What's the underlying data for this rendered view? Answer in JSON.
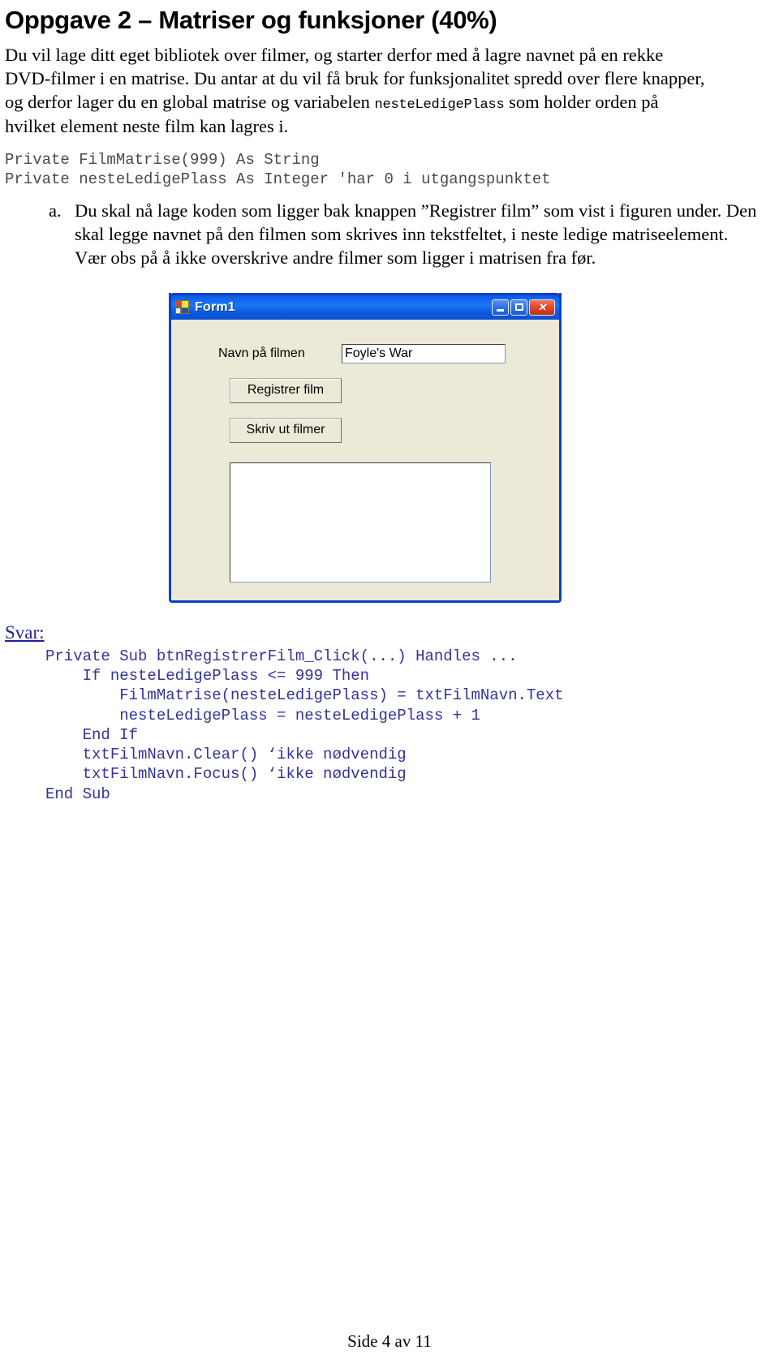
{
  "document": {
    "title": "Oppgave 2 – Matriser og funksjoner (40%)",
    "intro_part1": "Du vil lage ditt eget bibliotek over filmer, og starter derfor med å lagre navnet på en rekke DVD-filmer i en matrise. Du antar at du vil få bruk for funksjonalitet spredd over flere knapper, og derfor lager du en global matrise og variabelen ",
    "intro_mono": "nesteLedigePlass",
    "intro_part2": " som holder orden på hvilket element neste film kan lagres i.",
    "declaration_code": "Private FilmMatrise(999) As String\nPrivate nesteLedigePlass As Integer 'har 0 i utgangspunktet",
    "task_marker": "a.",
    "task_text": "Du skal nå lage koden som ligger bak knappen ”Registrer film” som vist i figuren under. Den skal legge navnet på den filmen som skrives inn tekstfeltet, i neste ledige matriseelement. Vær obs på å ikke overskrive andre filmer som ligger i matrisen fra før.",
    "answer_label": "Svar:",
    "answer_code": "Private Sub btnRegistrerFilm_Click(...) Handles ...\n    If nesteLedigePlass <= 999 Then\n        FilmMatrise(nesteLedigePlass) = txtFilmNavn.Text\n        nesteLedigePlass = nesteLedigePlass + 1\n    End If\n    txtFilmNavn.Clear() ‘ikke nødvendig\n    txtFilmNavn.Focus() ‘ikke nødvendig\nEnd Sub",
    "footer": "Side 4 av 11"
  },
  "figure": {
    "window_title": "Form1",
    "titlebar_buttons": {
      "minimize": "minimize-icon",
      "maximize": "maximize-icon",
      "close": "✕"
    },
    "label_film_name": "Navn på filmen",
    "textbox_value": "Foyle's War",
    "textbox_placeholder": "",
    "button_register": "Registrer film",
    "button_print": "Skriv ut filmer",
    "listbox_items": []
  },
  "colors": {
    "titlebar_blue": "#0f5ae0",
    "window_border": "#0a3fc4",
    "form_face": "#ece9d8",
    "answer_code": "#333399",
    "svar_blue": "#2020a0",
    "declaration_code": "#4a4a4a",
    "close_red": "#c32f13"
  }
}
